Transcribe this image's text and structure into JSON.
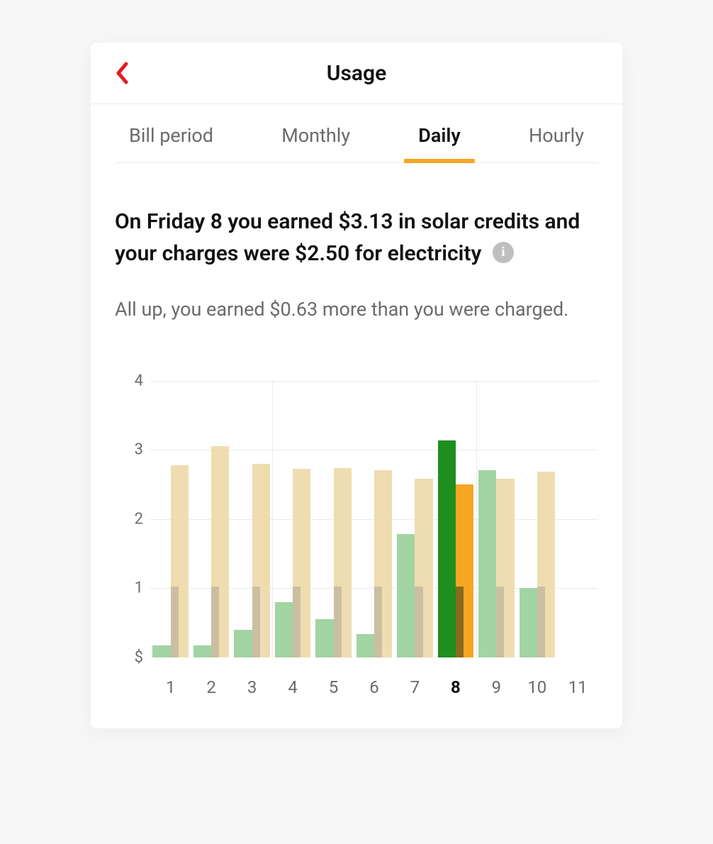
{
  "colors": {
    "accent_red": "#e31b23",
    "tab_indicator": "#f5a623",
    "credit_dim": "#a3d4a3",
    "charge_dim": "#efddb1",
    "charge_base_dim": "#cbbfa2",
    "credit_sel": "#1e8e1e",
    "charge_sel": "#f5a623",
    "charge_base_sel": "#8a6b1e"
  },
  "header": {
    "title": "Usage"
  },
  "tabs": {
    "items": [
      {
        "label": "Bill period",
        "active": false
      },
      {
        "label": "Monthly",
        "active": false
      },
      {
        "label": "Daily",
        "active": true
      },
      {
        "label": "Hourly",
        "active": false
      }
    ]
  },
  "headline": "On Friday 8 you earned $3.13 in solar credits and your charges were $2.50 for electricity",
  "subline": "All up, you earned $0.63 more than you were charged.",
  "chart_data": {
    "type": "bar",
    "ylabel": "$",
    "ylim": [
      0,
      4
    ],
    "yticks": [
      1,
      2,
      3,
      4
    ],
    "bottom_label": "$",
    "x": [
      1,
      2,
      3,
      4,
      5,
      6,
      7,
      8,
      9,
      10,
      11
    ],
    "selected_x": 8,
    "grid_after_x": [
      3,
      8
    ],
    "series": [
      {
        "name": "solar_credits",
        "values": [
          0.17,
          0.17,
          0.4,
          0.8,
          0.55,
          0.33,
          1.78,
          3.13,
          2.7,
          1.0,
          null
        ]
      },
      {
        "name": "charges_total",
        "values": [
          2.77,
          3.05,
          2.8,
          2.72,
          2.73,
          2.7,
          2.58,
          2.5,
          2.58,
          2.68,
          null
        ]
      },
      {
        "name": "charges_base",
        "values": [
          1.02,
          1.02,
          1.02,
          1.02,
          1.02,
          1.02,
          1.02,
          1.02,
          1.02,
          1.02,
          null
        ]
      }
    ]
  }
}
